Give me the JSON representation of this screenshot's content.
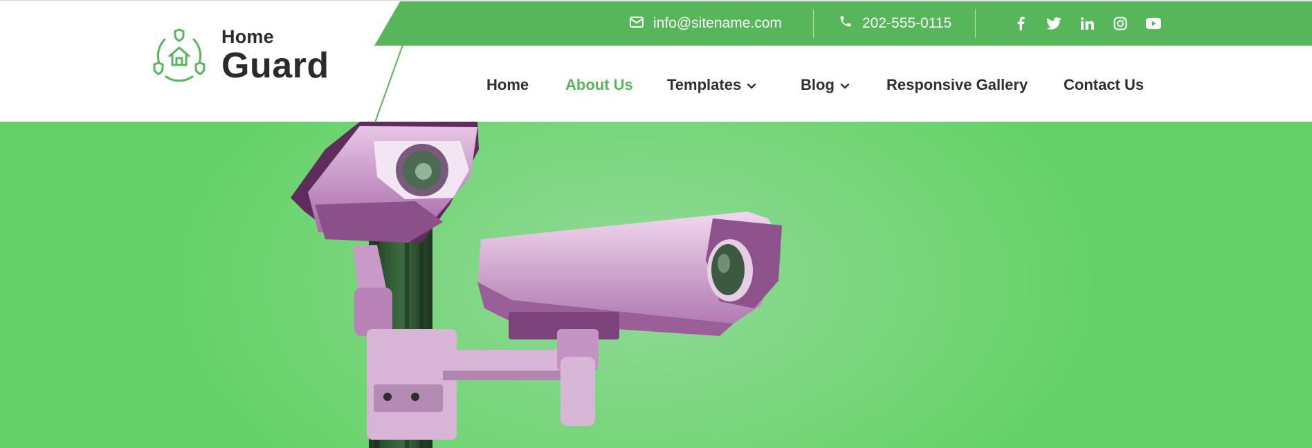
{
  "brand": {
    "name_top": "Home",
    "name_bottom": "Guard",
    "logo_icon": "house-shield-icon"
  },
  "topbar": {
    "email": "info@sitename.com",
    "email_icon": "envelope-icon",
    "phone": "202-555-0115",
    "phone_icon": "phone-icon",
    "background_color": "#57b65a",
    "socials": [
      {
        "icon": "facebook-icon"
      },
      {
        "icon": "twitter-icon"
      },
      {
        "icon": "linkedin-icon"
      },
      {
        "icon": "instagram-icon"
      },
      {
        "icon": "youtube-icon"
      }
    ]
  },
  "nav": {
    "items": [
      {
        "label": "Home",
        "active": false,
        "has_dropdown": false
      },
      {
        "label": "About Us",
        "active": true,
        "has_dropdown": false
      },
      {
        "label": "Templates",
        "active": false,
        "has_dropdown": true
      },
      {
        "label": "Blog",
        "active": false,
        "has_dropdown": true
      },
      {
        "label": "Responsive Gallery",
        "active": false,
        "has_dropdown": false
      },
      {
        "label": "Contact Us",
        "active": false,
        "has_dropdown": false
      }
    ],
    "active_color": "#57b65a",
    "text_color": "#2f2f2f"
  },
  "hero": {
    "image": "security-cameras-photo",
    "background_color": "#6dd46f"
  }
}
